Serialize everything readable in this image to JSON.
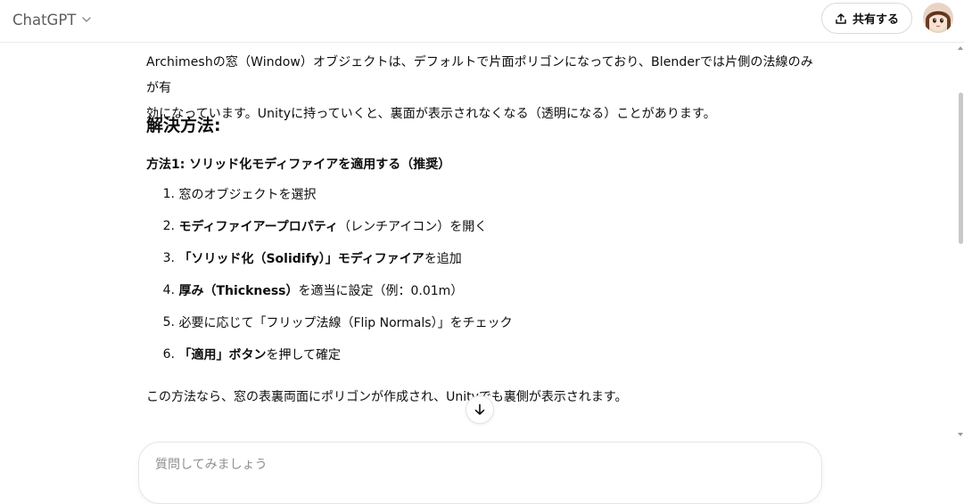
{
  "header": {
    "model_name": "ChatGPT",
    "share_label": "共有する"
  },
  "message": {
    "intro_line1": "Archimeshの窓（Window）オブジェクトは、デフォルトで片面ポリゴンになっており、Blenderでは片側の法線のみが有",
    "intro_line2": "効になっています。Unityに持っていくと、裏面が表示されなくなる（透明になる）ことがあります。",
    "heading": "解決方法:",
    "method_title": "方法1: ソリッド化モディファイアを適用する（推奨）",
    "steps": [
      {
        "num": "1.",
        "bold": "",
        "text": "窓のオブジェクトを選択"
      },
      {
        "num": "2.",
        "bold": "モディファイアープロパティ",
        "text": "（レンチアイコン）を開く"
      },
      {
        "num": "3.",
        "bold": "「ソリッド化（Solidify）」モディファイア",
        "text": "を追加"
      },
      {
        "num": "4.",
        "bold": "厚み（Thickness）",
        "text": " を適当に設定（例：0.01m）"
      },
      {
        "num": "5.",
        "bold": "",
        "text": "必要に応じて「フリップ法線（Flip Normals）」をチェック"
      },
      {
        "num": "6.",
        "bold": "「適用」ボタン",
        "text": " を押して確定"
      }
    ],
    "closing": "この方法なら、窓の表裏両面にポリゴンが作成され、Unityでも裏側が表示されます。"
  },
  "composer": {
    "placeholder": "質問してみましょう"
  },
  "icons": {
    "model_chevron": "chevron-down-icon",
    "share": "share-upload-icon",
    "scroll_down": "arrow-down-icon"
  },
  "colors": {
    "text": "#0d0d0d",
    "muted": "#5d5d5d",
    "border": "#e5e5e5"
  }
}
